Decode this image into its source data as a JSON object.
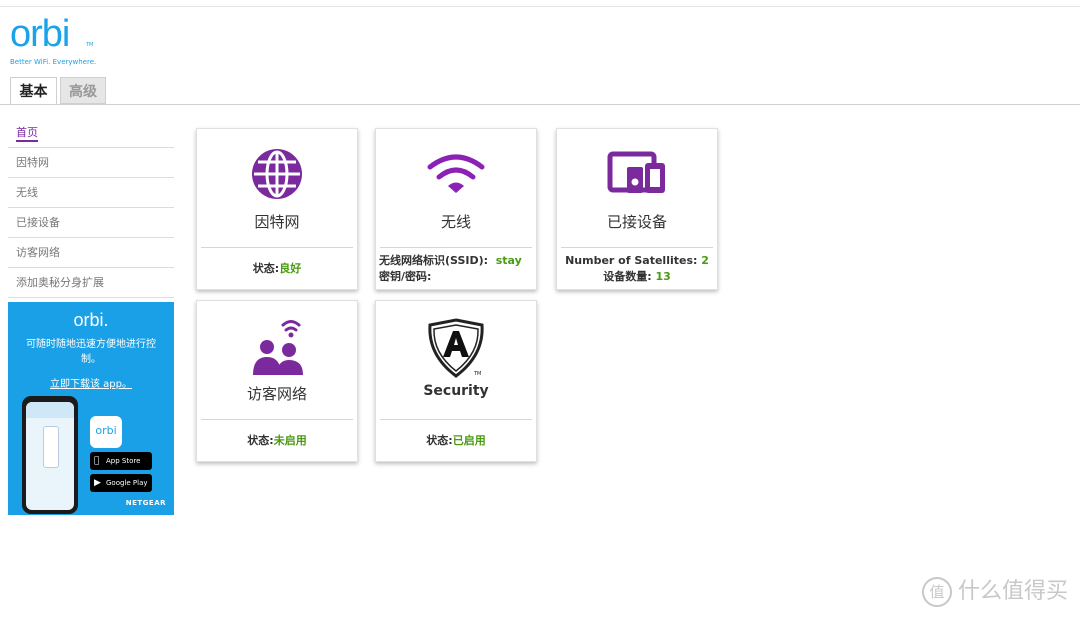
{
  "logo": {
    "name": "orbi",
    "tm": "TM",
    "tagline": "Better WiFi. Everywhere."
  },
  "tabs": [
    {
      "label": "基本",
      "active": true
    },
    {
      "label": "高级",
      "active": false
    }
  ],
  "sidebar": {
    "items": [
      {
        "label": "首页",
        "active": true
      },
      {
        "label": "因特网"
      },
      {
        "label": "无线"
      },
      {
        "label": "已接设备"
      },
      {
        "label": "访客网络"
      },
      {
        "label": "添加奥秘分身扩展"
      }
    ]
  },
  "promo": {
    "logo": "orbi.",
    "text": "可随时随地迅速方便地进行控制。",
    "link": "立即下载该 app。",
    "app_icon_label": "orbi",
    "app_icon_sub": "NETGEAR",
    "app_store": "App Store",
    "google_play": "Google Play",
    "brand": "NETGEAR"
  },
  "cards": {
    "internet": {
      "title": "因特网",
      "status_label": "状态:",
      "status_value": "良好",
      "icon": "globe-icon"
    },
    "wireless": {
      "title": "无线",
      "ssid_label": "无线网络标识(SSID):",
      "ssid_value": "stay",
      "password_label": "密钥/密码:",
      "icon": "wifi-icon"
    },
    "devices": {
      "title": "已接设备",
      "satellites_label": "Number of Satellites:",
      "satellites_value": "2",
      "count_label": "设备数量:",
      "count_value": "13",
      "icon": "devices-icon"
    },
    "guest": {
      "title": "访客网络",
      "status_label": "状态:",
      "status_value": "未启用",
      "icon": "guest-network-icon"
    },
    "security": {
      "title": "Security",
      "status_label": "状态:",
      "status_value": "已启用",
      "icon": "armor-shield-icon"
    }
  },
  "colors": {
    "accent": "#7b2a9e",
    "brand_blue": "#1aa0e6",
    "ok_green": "#4a9a12"
  },
  "watermark": {
    "badge": "值",
    "text": "什么值得买"
  }
}
